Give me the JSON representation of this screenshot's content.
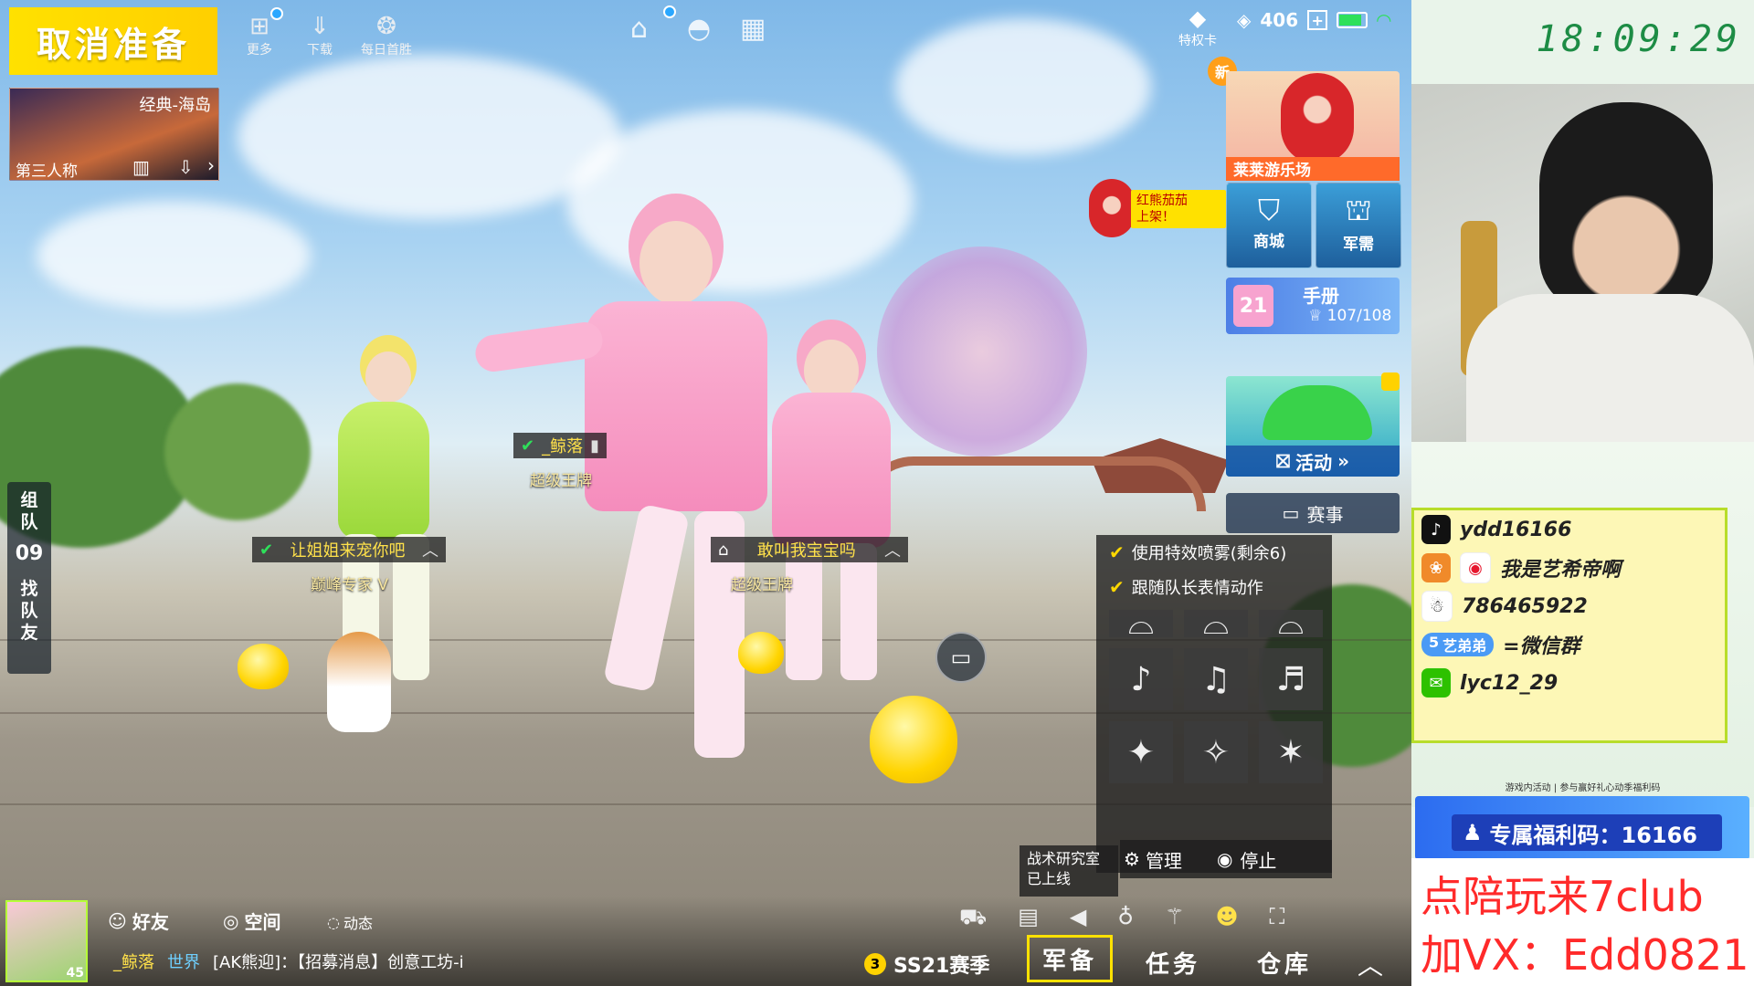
{
  "top_left": {
    "cancel_ready": "取消准备",
    "map_mode": "经典-海岛",
    "perspective": "第三人称",
    "icons": [
      {
        "name": "more-icon",
        "label": "更多"
      },
      {
        "name": "download-icon",
        "label": "下载"
      },
      {
        "name": "daily-icon",
        "label": "每日首胜"
      }
    ]
  },
  "status_bar": {
    "privilege_card": "特权卡",
    "currency": "406",
    "add": "+"
  },
  "right_panel": {
    "new_badge": "新",
    "event_banner": "莱莱游乐场",
    "promo_bubble": "红熊茄茄\n上架！",
    "shop": "商城",
    "armory": "军需",
    "handbook_title": "手册",
    "handbook_progress": "107/108",
    "handbook_level": "21",
    "activity": "活动",
    "tournament": "赛事"
  },
  "players": [
    {
      "name": "_鲸落",
      "rank": "超级王牌"
    },
    {
      "name": "让姐姐来宠你吧",
      "rank": "巅峰专家 V"
    },
    {
      "name": "敢叫我宝宝吗",
      "rank": "超级王牌"
    }
  ],
  "side_bar": {
    "team": "组\n队",
    "team_count": "09",
    "find": "找\n队\n友"
  },
  "emote_panel": {
    "options": [
      "使用特效喷雾(剩余6)",
      "跟随队长表情动作"
    ],
    "manage": "管理",
    "stop": "停止"
  },
  "tooltip": "战术研究室\n已上线",
  "bottom": {
    "friends": "好友",
    "space": "空间",
    "feed": "动态",
    "chat_user": "_鲸落",
    "chat_channel": "世界",
    "chat_text": "[AK熊迎]：【招募消息】创意工坊-i",
    "avatar_level": "45",
    "season": "SS21赛季",
    "season_num": "3",
    "nav": [
      "军备",
      "任务",
      "仓库"
    ]
  },
  "overlay": {
    "clock": "18:09:29",
    "social": [
      {
        "icon": "douyin-icon",
        "text": "ydd16166"
      },
      {
        "icon": "weibo-icon",
        "text": "我是艺希帝啊"
      },
      {
        "icon": "qq-icon",
        "text": "786465922"
      },
      {
        "icon": "fans-icon",
        "badge": "艺弟弟",
        "badge_level": "5",
        "text": "=微信群"
      },
      {
        "icon": "wechat-icon",
        "text": "lyc12_29"
      }
    ],
    "promo_small": "游戏内活动 | 参与赢好礼心动季福利码",
    "promo_code": "专属福利码：16166",
    "ad_line1": "点陪玩来7club",
    "ad_line2": "加VX：Edd0821"
  },
  "colors": {
    "accent_yellow": "#ffe100",
    "clock_green": "#1d8c45",
    "ad_red": "#ff2a2a",
    "promo_blue": "#2c6cf0"
  }
}
